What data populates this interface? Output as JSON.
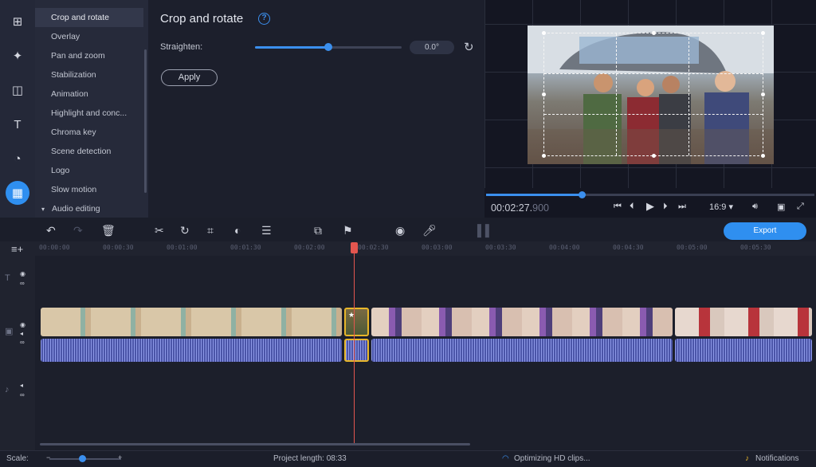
{
  "tools": {
    "items": [
      {
        "label": "Crop and rotate",
        "selected": true
      },
      {
        "label": "Overlay"
      },
      {
        "label": "Pan and zoom"
      },
      {
        "label": "Stabilization"
      },
      {
        "label": "Animation"
      },
      {
        "label": "Highlight and conc..."
      },
      {
        "label": "Chroma key"
      },
      {
        "label": "Scene detection"
      },
      {
        "label": "Logo"
      },
      {
        "label": "Slow motion"
      },
      {
        "label": "Audio editing"
      }
    ]
  },
  "props": {
    "title": "Crop and rotate",
    "straighten_label": "Straighten:",
    "straighten_value": "0.0°",
    "straighten_fraction": 0.5,
    "apply_label": "Apply"
  },
  "preview": {
    "time_main": "00:02:27.",
    "time_frac": "900",
    "playback_fraction": 0.29,
    "aspect": "16:9 ▾"
  },
  "toolbar": {
    "export_label": "Export"
  },
  "ruler": {
    "ticks": [
      "00:00:00",
      "00:00:30",
      "00:01:00",
      "00:01:30",
      "00:02:00",
      "00:02:30",
      "00:03:00",
      "00:03:30",
      "00:04:00",
      "00:04:30",
      "00:05:00",
      "00:05:30"
    ]
  },
  "status": {
    "scale_label": "Scale:",
    "project_length_label": "Project length:",
    "project_length_value": "08:33",
    "optimizing_label": "Optimizing HD clips...",
    "notifications_label": "Notifications"
  },
  "colors": {
    "accent": "#2f8ff0",
    "playhead": "#e4564f",
    "selected_clip": "#e8b62a"
  }
}
